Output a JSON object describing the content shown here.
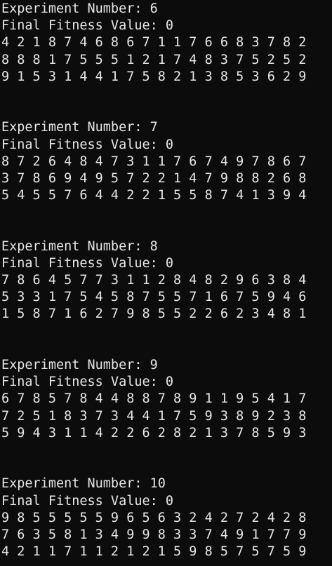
{
  "colors": {
    "background": "#0c0c0c",
    "text": "#e6e6e6"
  },
  "experiments": [
    {
      "header": "Experiment Number: 6",
      "fitness": "Final Fitness Value: 0",
      "rows": [
        "4 2 1 8 7 4 6 8 6 7 1 1 7 6 6 8 3 7 8 2",
        "8 8 8 1 7 5 5 5 1 2 1 7 4 8 3 7 5 2 5 2",
        "9 1 5 3 1 4 4 1 7 5 8 2 1 3 8 5 3 6 2 9"
      ]
    },
    {
      "header": "Experiment Number: 7",
      "fitness": "Final Fitness Value: 0",
      "rows": [
        "8 7 2 6 4 8 4 7 3 1 1 7 6 7 4 9 7 8 6 7",
        "3 7 8 6 9 4 9 5 7 2 2 1 4 7 9 8 8 2 6 8",
        "5 4 5 5 7 6 4 4 2 2 1 5 5 8 7 4 1 3 9 4"
      ]
    },
    {
      "header": "Experiment Number: 8",
      "fitness": "Final Fitness Value: 0",
      "rows": [
        "7 8 6 4 5 7 7 3 1 1 2 8 4 8 2 9 6 3 8 4",
        "5 3 3 1 7 5 4 5 8 7 5 5 7 1 6 7 5 9 4 6",
        "1 5 8 7 1 6 2 7 9 8 5 5 2 2 6 2 3 4 8 1"
      ]
    },
    {
      "header": "Experiment Number: 9",
      "fitness": "Final Fitness Value: 0",
      "rows": [
        "6 7 8 5 7 8 4 4 8 8 7 8 9 1 1 9 5 4 1 7",
        "7 2 5 1 8 3 7 3 4 4 1 7 5 9 3 8 9 2 3 8",
        "5 9 4 3 1 1 4 2 2 6 2 8 2 1 3 7 8 5 9 3"
      ]
    },
    {
      "header": "Experiment Number: 10",
      "fitness": "Final Fitness Value: 0",
      "rows": [
        "9 8 5 5 5 5 5 9 6 5 6 3 2 4 2 7 2 4 2 8",
        "7 6 3 5 8 1 3 4 9 9 8 3 3 7 4 9 1 7 7 9",
        "4 2 1 1 7 1 1 2 1 2 1 5 9 8 5 7 5 7 5 9"
      ]
    }
  ]
}
